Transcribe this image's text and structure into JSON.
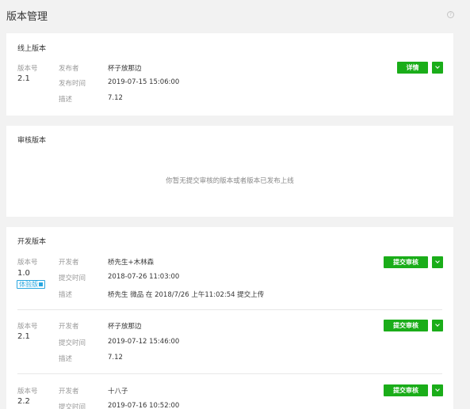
{
  "header": {
    "title": "版本管理",
    "help_icon": "question-circle-icon",
    "help_glyph": "?"
  },
  "online": {
    "title": "线上版本",
    "version_label": "版本号",
    "version": "2.1",
    "publisher_label": "发布者",
    "publisher": "杯子放那边",
    "time_label": "发布时间",
    "time": "2019-07-15 15:06:00",
    "desc_label": "描述",
    "desc": "7.12",
    "detail_button": "详情"
  },
  "review": {
    "title": "审核版本",
    "empty_text": "你暂无提交审核的版本或者版本已发布上线"
  },
  "dev": {
    "title": "开发版本",
    "submit_label": "提交审核",
    "versions": [
      {
        "version_label": "版本号",
        "version": "1.0",
        "experience_tag": "体验版",
        "developer_label": "开发者",
        "developer": "桥先生+木林森",
        "time_label": "提交时间",
        "time": "2018-07-26 11:03:00",
        "desc_label": "描述",
        "desc": "桥先生 微品 在 2018/7/26 上午11:02:54 提交上传"
      },
      {
        "version_label": "版本号",
        "version": "2.1",
        "developer_label": "开发者",
        "developer": "杯子放那边",
        "time_label": "提交时间",
        "time": "2019-07-12 15:46:00",
        "desc_label": "描述",
        "desc": "7.12"
      },
      {
        "version_label": "版本号",
        "version": "2.2",
        "developer_label": "开发者",
        "developer": "十八子",
        "time_label": "提交时间",
        "time": "2019-07-16 10:52:00"
      }
    ]
  },
  "colors": {
    "primary_green": "#1aad19",
    "tag_blue": "#2aa7e0",
    "page_bg": "#f2f2f2"
  }
}
